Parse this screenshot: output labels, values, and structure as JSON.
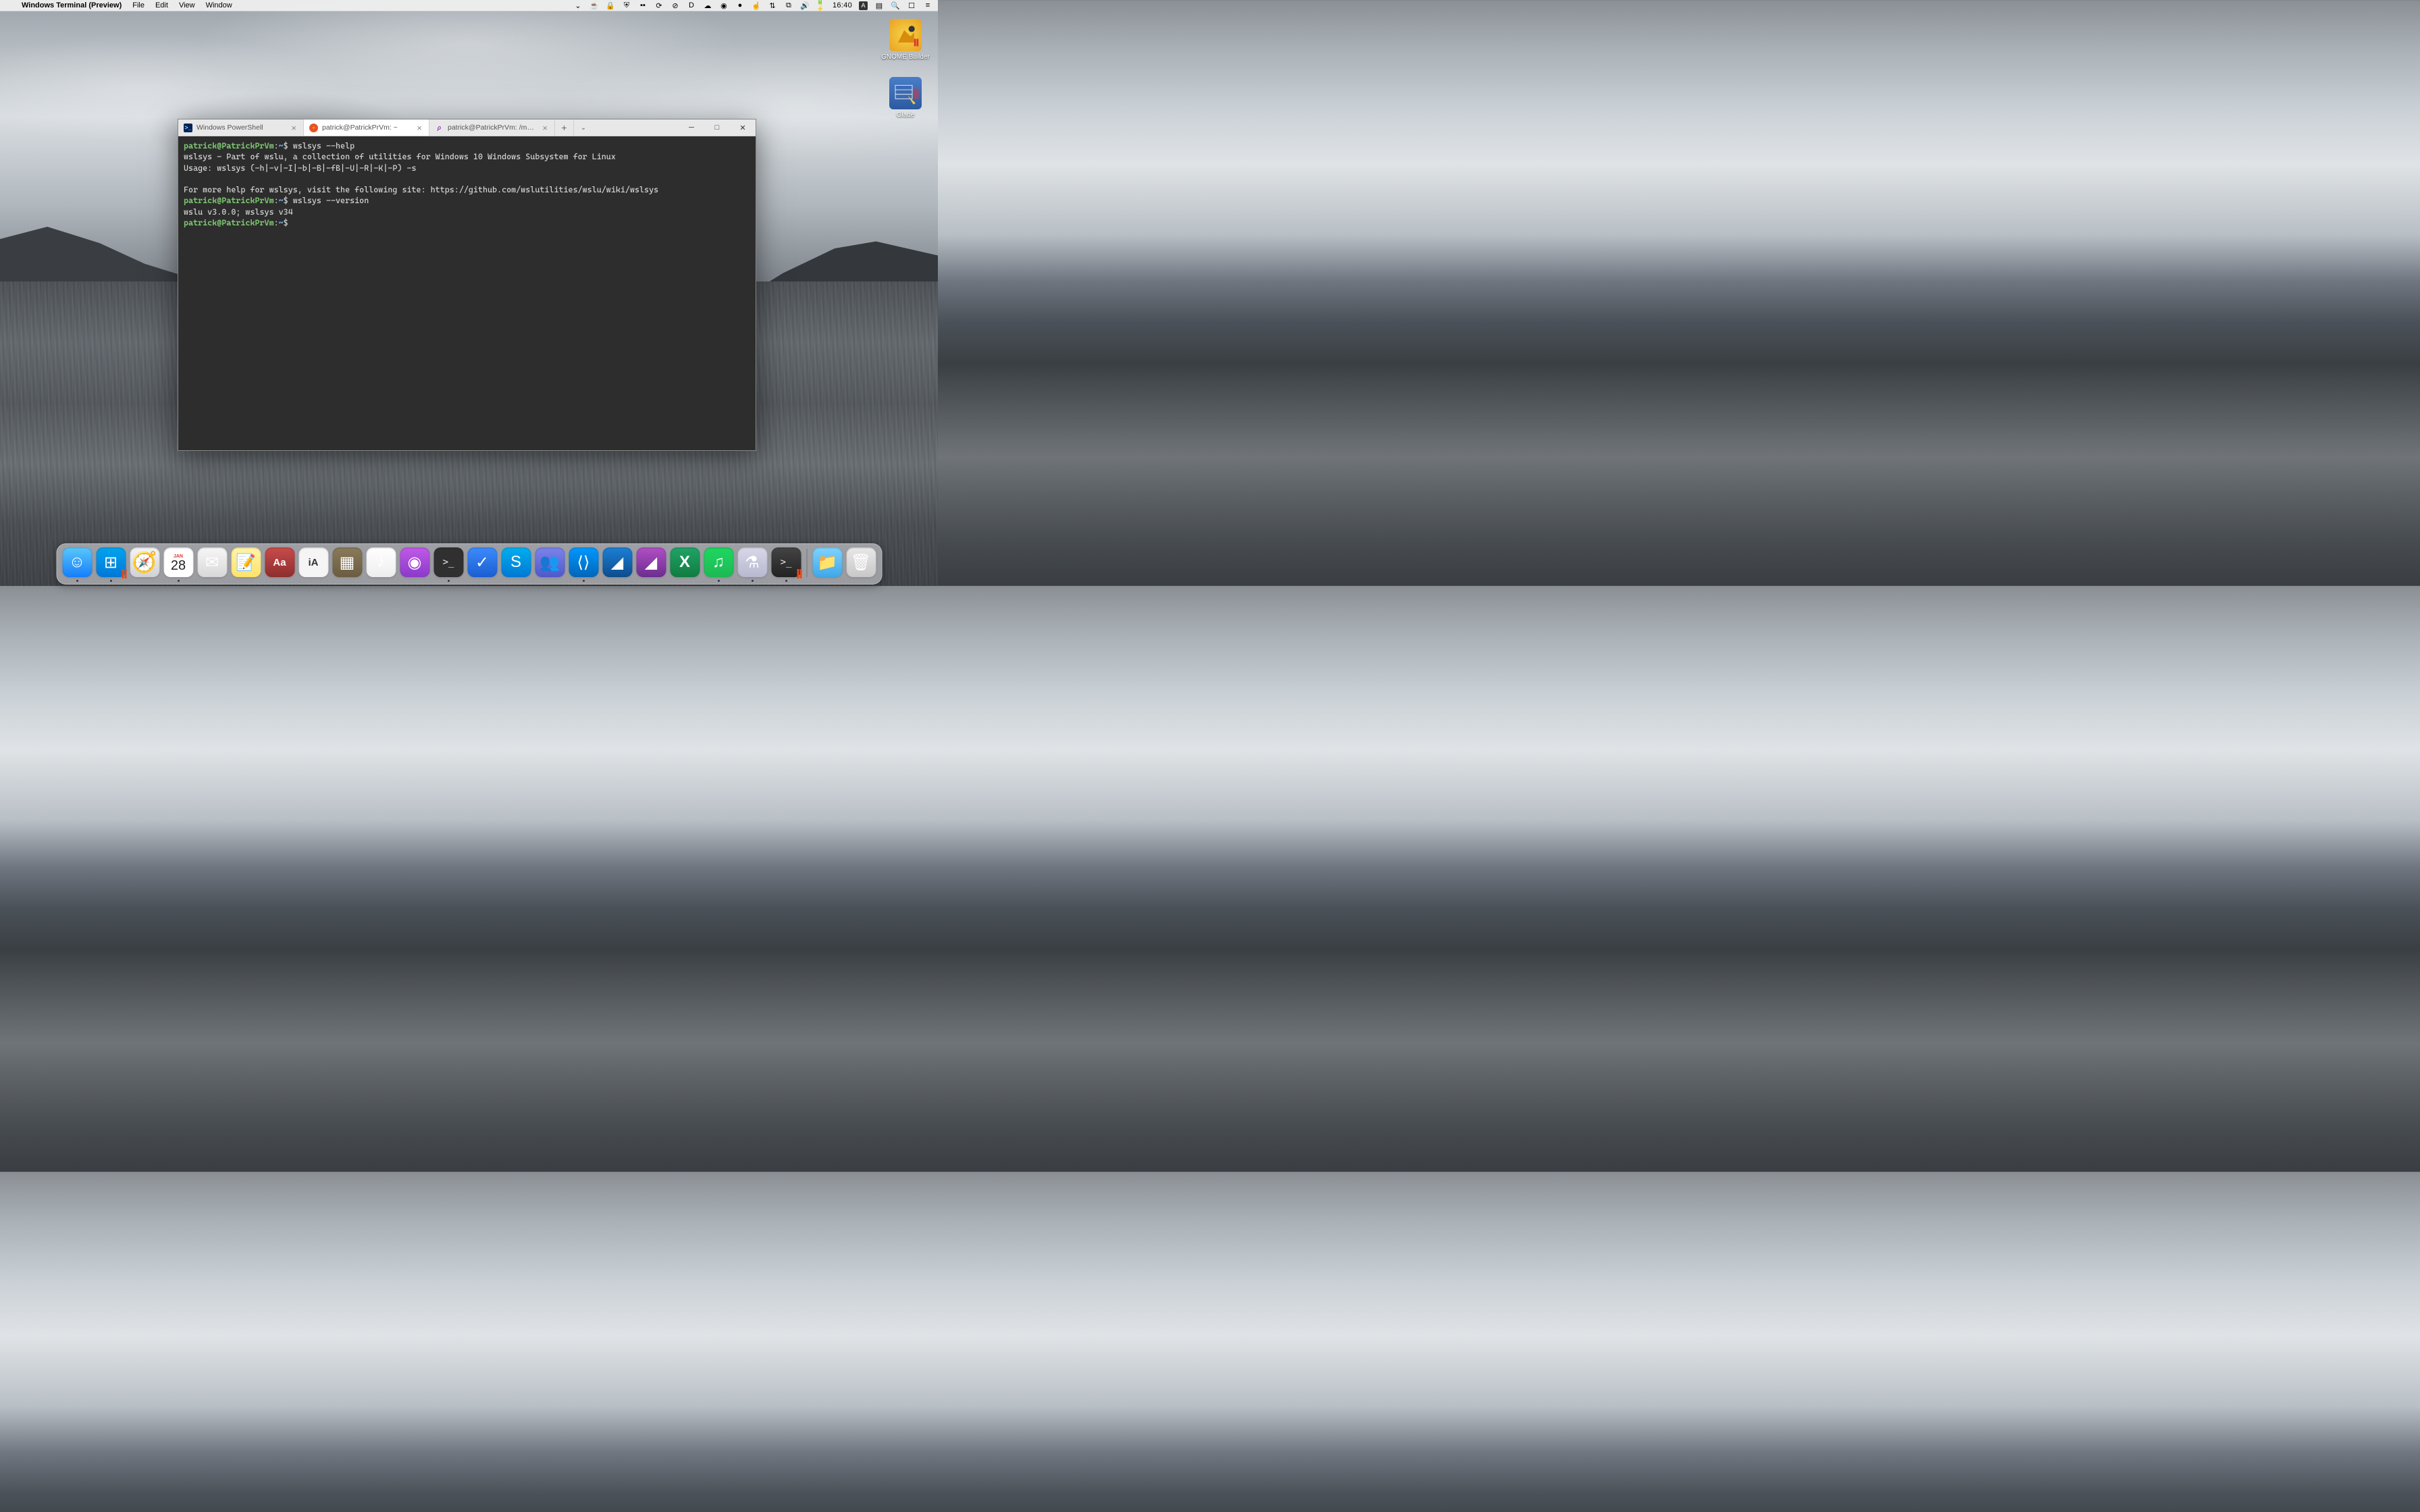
{
  "menubar": {
    "app_name": "Windows Terminal (Preview)",
    "menus": [
      "File",
      "Edit",
      "View",
      "Window"
    ],
    "clock": "16:40",
    "battery_text": "",
    "indicator_a": "A"
  },
  "desktop_icons": [
    {
      "label": "GNOME Builder"
    },
    {
      "label": "Glade"
    }
  ],
  "terminal": {
    "tabs": [
      {
        "label": "Windows PowerShell",
        "icon_bg": "#012456",
        "icon_fg": "#fff",
        "icon_glyph": ">_"
      },
      {
        "label": "patrick@PatrickPrVm: ~",
        "icon_bg": "#e95420",
        "icon_fg": "#fff",
        "icon_glyph": ""
      },
      {
        "label": "patrick@PatrickPrVm: /mnt/mac",
        "icon_bg": "#fff",
        "icon_fg": "#a347ba",
        "icon_glyph": "∞"
      }
    ],
    "active_tab": 1,
    "prompt_user_host": "patrick@PatrickPrVm",
    "prompt_sep": ":",
    "prompt_path": "~",
    "prompt_char": "$",
    "lines": {
      "cmd1": " wslsys --help",
      "out1": "wslsys - Part of wslu, a collection of utilities for Windows 10 Windows Subsystem for Linux",
      "out2": "Usage: wslsys (-h|-v|-I|-b|-B|-fB|-U|-R|-K|-P) -s",
      "out3": "",
      "out4": "For more help for wslsys, visit the following site: https://github.com/wslutilities/wslu/wiki/wslsys",
      "cmd2": " wslsys --version",
      "out5": "wslu v3.0.0; wslsys v34"
    }
  },
  "dock": {
    "calendar_month": "JAN",
    "calendar_day": "28",
    "items": [
      {
        "name": "finder",
        "running": true,
        "bg": "linear-gradient(#5ac8fa,#157efb)"
      },
      {
        "name": "windows-explorer",
        "running": true,
        "bg": "linear-gradient(#00a4ef,#0078d7)"
      },
      {
        "name": "safari",
        "running": false,
        "bg": "linear-gradient(#f5f5f7,#d1d1d6)"
      },
      {
        "name": "calendar",
        "running": true,
        "bg": "#ffffff"
      },
      {
        "name": "mail",
        "running": false,
        "bg": "linear-gradient(#f7f7f7,#d8d8d8)"
      },
      {
        "name": "notes",
        "running": false,
        "bg": "linear-gradient(#fff4a8,#ffe26b)"
      },
      {
        "name": "dictionary",
        "running": false,
        "bg": "linear-gradient(#c94b4b,#8e2e2e)"
      },
      {
        "name": "ia-writer",
        "running": false,
        "bg": "#f5f5f5"
      },
      {
        "name": "box",
        "running": false,
        "bg": "linear-gradient(#8a7a5a,#6b5d42)"
      },
      {
        "name": "music",
        "running": false,
        "bg": "linear-gradient(#fff,#eee)"
      },
      {
        "name": "podcasts",
        "running": false,
        "bg": "linear-gradient(#c159e8,#8a3ac9)"
      },
      {
        "name": "terminal-mac",
        "running": true,
        "bg": "#303030"
      },
      {
        "name": "todo",
        "running": false,
        "bg": "linear-gradient(#3d8bfd,#1a5fd0)"
      },
      {
        "name": "skype",
        "running": false,
        "bg": "linear-gradient(#00aff0,#0078d4)"
      },
      {
        "name": "teams",
        "running": false,
        "bg": "linear-gradient(#7b83eb,#5059c9)"
      },
      {
        "name": "vscode",
        "running": true,
        "bg": "linear-gradient(#0098ff,#0066b8)"
      },
      {
        "name": "affinity-designer",
        "running": false,
        "bg": "linear-gradient(#1b7fd6,#0d4c8c)"
      },
      {
        "name": "affinity-photo",
        "running": false,
        "bg": "linear-gradient(#b14fc5,#6a2e8f)"
      },
      {
        "name": "excel",
        "running": false,
        "bg": "linear-gradient(#21a366,#107c41)"
      },
      {
        "name": "spotify",
        "running": true,
        "bg": "linear-gradient(#1ed760,#1db954)"
      },
      {
        "name": "emacs",
        "running": true,
        "bg": "linear-gradient(#d8d8e8,#b8b8d0)"
      },
      {
        "name": "windows-terminal",
        "running": true,
        "bg": "linear-gradient(#444,#222)"
      }
    ],
    "right_items": [
      {
        "name": "downloads",
        "bg": "linear-gradient(#7fd3ff,#3fa8e8)"
      },
      {
        "name": "trash",
        "bg": "linear-gradient(#e8e8e8,#c8c8c8)"
      }
    ]
  }
}
